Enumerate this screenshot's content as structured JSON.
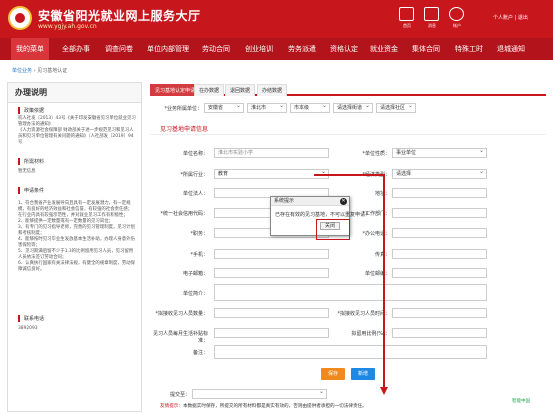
{
  "header": {
    "site_title": "安徽省阳光就业网上服务大厅",
    "site_url": "www.ygjy.ah.gov.cn",
    "icons": [
      "home-icon",
      "mail-icon",
      "user-icon"
    ],
    "icon_labels": [
      "首页",
      "消息",
      "帐户"
    ],
    "user_link": "个人账户 | 退出"
  },
  "nav": {
    "items": [
      "我的菜单",
      "全部办事",
      "调查问卷",
      "单位内部管理",
      "劳动合同",
      "创业培训",
      "劳务派遣",
      "资格认定",
      "就业资金",
      "集体合同",
      "特殊工时",
      "退城通知"
    ]
  },
  "breadcrumb": {
    "home": "单位业务",
    "sep": "›",
    "current": "见习基地认证"
  },
  "left": {
    "title": "办理说明",
    "sections": [
      {
        "title": "政策依据",
        "text": "皖人社发〔2013〕43号《关于印发安徽省见习单位就业见习管理办法的通知》\n《人力资源社会保障部 财政部关于进一步规范见习和见习人员和见习单位管理有关问题的通知》（人社部发〔2019〕94号"
      },
      {
        "title": "所需材料",
        "text": "暂无信息"
      },
      {
        "title": "申请条件",
        "text": "1、符合我省产业发展导向且具有一定发展潜力，有一定规模，有良好的经济效益和社会信誉，有较强的社会责任感；在行业内具有较强示范性，并对就业见习工作有积极性；\n2、能够提供一定数量或有一定数量的见习岗位；\n3、有专门的见习指导老师，完善的见习管理制度，见习计划和考核制度；\n4、能够按时见习毕业生发放基本生活补助，办理人身意外伤害保险等；\n5、见习期满后留不少于1.3的比例留用见习人员，见习留用人员依法签订劳动合同；\n6、认真执行国家有关法律法规，有健全的规章制度，劳动保障诚信良好。"
      },
      {
        "title": "联系电话",
        "text": "3892093"
      }
    ]
  },
  "tabs": [
    "见习基地认定申请",
    "在办数据",
    "退回数据",
    "办结数据"
  ],
  "form": {
    "business_unit_label": "*业务所属单位：",
    "region": [
      "安徽省",
      "淮北市",
      "市本级",
      "请选择街道",
      "请选择社区"
    ],
    "section_title": "见习基地申请信息",
    "fields": {
      "unit_name": {
        "label": "单位名称：",
        "value": "淮北市实验小学"
      },
      "unit_type": {
        "label": "*单位性质：",
        "value": "事业单位"
      },
      "industry": {
        "label": "*所属行业：",
        "value": "教育"
      },
      "econ_type": {
        "label": "*经济类型：",
        "value": "请选择"
      },
      "legal_person": {
        "label": "单位法人：",
        "value": ""
      },
      "address": {
        "label": "地址：",
        "value": ""
      },
      "org_code": {
        "label": "*统一社会信用代码：",
        "value": ""
      },
      "work_dept": {
        "label": "*工作部门：",
        "value": ""
      },
      "position": {
        "label": "*职务：",
        "value": ""
      },
      "office_phone": {
        "label": "*办公电话：",
        "value": ""
      },
      "mobile": {
        "label": "*手机：",
        "value": ""
      },
      "fax": {
        "label": "传真：",
        "value": ""
      },
      "email": {
        "label": "电子邮箱：",
        "value": ""
      },
      "postcode": {
        "label": "单位邮编：",
        "value": ""
      },
      "unit_intro": {
        "label": "单位简介：",
        "value": ""
      },
      "plan_count": {
        "label": "*拟接收见习人员数量：",
        "value": ""
      },
      "plan_time": {
        "label": "*拟接收见习人员时间：",
        "value": ""
      },
      "intern_hire": {
        "label": "见习人员每月生活补贴标准：",
        "value": ""
      },
      "retain_rate": {
        "label": "拟留用比例(%)：",
        "value": ""
      },
      "remark": {
        "label": "备注：",
        "value": ""
      },
      "submit_to": {
        "label": "提交至：",
        "value": ""
      }
    },
    "save_label": "保存",
    "add_label": "新增"
  },
  "modal": {
    "title": "系统提示",
    "message": "已存在有效的见习基地，不可以重复申请！",
    "close_label": "关闭"
  },
  "tip": {
    "prefix": "友情提示：",
    "text": "本数据实时保存，所提交的所有材料都是真实有效的，否则由提供者承担的一切法律责任。"
  },
  "watermark": "智能中国"
}
